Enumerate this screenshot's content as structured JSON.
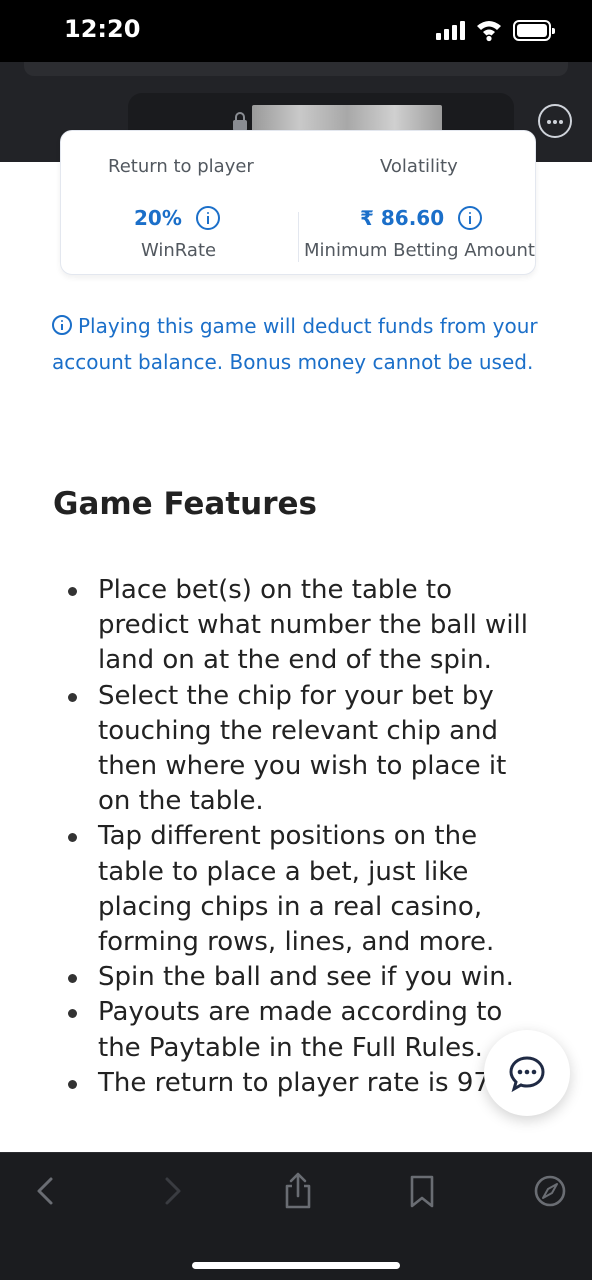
{
  "status_bar": {
    "time": "12:20"
  },
  "browser": {
    "url_text": "",
    "more_button_label": "More"
  },
  "stats": {
    "rtp_label": "Return to player",
    "volatility_label": "Volatility",
    "winrate_value": "20%",
    "winrate_label": "WinRate",
    "min_bet_value": "₹ 86.60",
    "min_bet_label": "Minimum Betting Amount"
  },
  "notice": {
    "text": "Playing this game will deduct funds from your account balance. Bonus money cannot be used."
  },
  "features": {
    "title": "Game Features",
    "items": [
      "Place bet(s) on the table to predict what number the ball will land on at the end of the spin.",
      "Select the chip for your bet by touching the relevant chip and then where you wish to place it on the table.",
      "Tap different positions on the table to place a bet, just like placing chips in a real casino, forming rows, lines, and more.",
      "Spin the ball and see if you win.",
      "Payouts are made according to the Paytable in the Full Rules.",
      "The return to player rate is 97."
    ]
  },
  "icons": {
    "lock": "lock-icon",
    "info": "info-icon",
    "chat": "chat-icon",
    "back": "chevron-left-icon",
    "forward": "chevron-right-icon",
    "share": "share-icon",
    "bookmarks": "bookmark-icon",
    "compass": "compass-icon"
  },
  "colors": {
    "accent": "#1b6fc9",
    "text": "#222222",
    "muted": "#52585f",
    "chrome_bg": "#222327"
  }
}
